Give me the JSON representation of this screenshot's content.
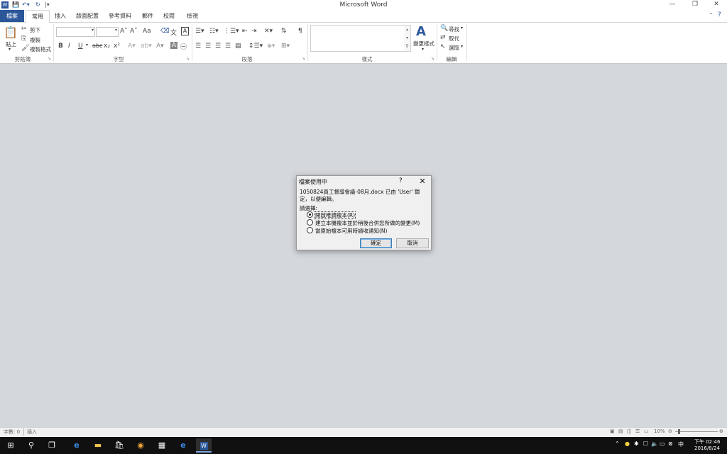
{
  "window": {
    "title": "Microsoft Word",
    "controls": {
      "minimize": "—",
      "restore": "❐",
      "close": "✕"
    }
  },
  "tabs": {
    "file": "檔案",
    "items": [
      "常用",
      "插入",
      "版面配置",
      "參考資料",
      "郵件",
      "校閱",
      "檢視"
    ]
  },
  "ribbon": {
    "clipboard": {
      "paste": "貼上",
      "cut": "剪下",
      "copy": "複製",
      "format_painter": "複製格式",
      "label": "剪貼簿"
    },
    "font": {
      "label": "字型",
      "bold": "B",
      "italic": "I",
      "underline": "U",
      "strike": "abc",
      "subscript": "x₂",
      "superscript": "x²",
      "grow": "A˄",
      "shrink": "A˅",
      "change_case": "Aa"
    },
    "paragraph": {
      "label": "段落"
    },
    "styles": {
      "label": "樣式",
      "change_styles": "變更樣式"
    },
    "editing": {
      "label": "編輯",
      "find": "尋找",
      "replace": "取代",
      "select": "選取"
    }
  },
  "dialog": {
    "title": "檔案使用中",
    "help": "?",
    "close": "✕",
    "message": "1050824員工督導會議-08月.docx 已由 'User' 鎖定，以便編輯。",
    "prompt": "請選擇:",
    "options": [
      {
        "label": "開啟唯讀複本(R)",
        "selected": true
      },
      {
        "label": "建立本機複本並於稍後合併您所做的變更(M)",
        "selected": false
      },
      {
        "label": "當原始複本可用時請收通知(N)",
        "selected": false
      }
    ],
    "ok": "確定",
    "cancel": "取消"
  },
  "statusbar": {
    "words": "字數: 0",
    "mode": "插入",
    "zoom": "10%"
  },
  "taskbar": {
    "time": "下午 02:46",
    "date": "2016/8/24"
  },
  "colors": {
    "accent": "#2b579a",
    "document_bg": "#d4d7dc",
    "taskbar": "#101010"
  }
}
